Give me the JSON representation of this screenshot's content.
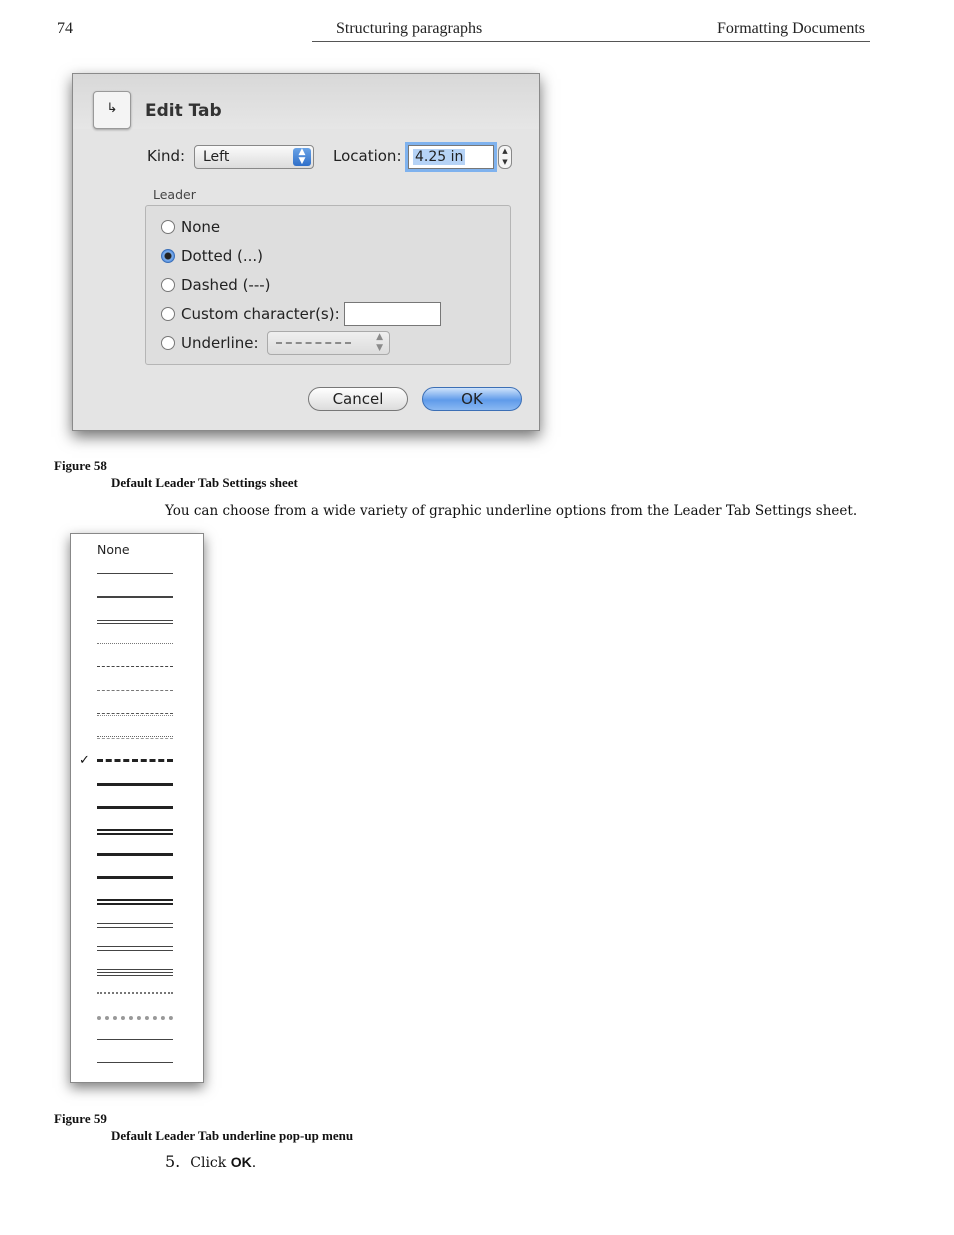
{
  "header": {
    "page_number": "74",
    "section": "Structuring paragraphs",
    "chapter": "Formatting Documents"
  },
  "dialog": {
    "title": "Edit Tab",
    "tab_icon": "left-tab-icon",
    "kind_label": "Kind:",
    "kind_value": "Left",
    "location_label": "Location:",
    "location_value": "4.25 in",
    "leader_label": "Leader",
    "options": [
      {
        "label": "None",
        "selected": false
      },
      {
        "label": "Dotted (...)",
        "selected": true
      },
      {
        "label": "Dashed (---)",
        "selected": false
      },
      {
        "label": "Custom character(s):",
        "selected": false
      },
      {
        "label": "Underline:",
        "selected": false
      }
    ],
    "custom_value": "",
    "cancel_label": "Cancel",
    "ok_label": "OK"
  },
  "figure58": {
    "number": "Figure 58",
    "caption": "Default Leader Tab Settings sheet"
  },
  "body_text": "You can choose from a wide variety of graphic underline options from the Leader Tab Settings sheet.",
  "underline_menu": {
    "none_label": "None",
    "check_mark": "✓",
    "items": [
      "thin",
      "medium",
      "double-thin",
      "dotted-fine",
      "dashed",
      "dashed-fine",
      "dash-dot",
      "dash-dot-dot",
      "thick-dashed",
      "thick",
      "thick",
      "thick-double",
      "thick",
      "thick",
      "thick-double",
      "double",
      "double",
      "triple",
      "wave",
      "wave-thick",
      "thin",
      "thin"
    ],
    "selected_index": 8
  },
  "figure59": {
    "number": "Figure 59",
    "caption": "Default Leader Tab underline pop-up menu"
  },
  "step": {
    "number": "5.",
    "text": "Click ",
    "action": "OK",
    "end": "."
  }
}
